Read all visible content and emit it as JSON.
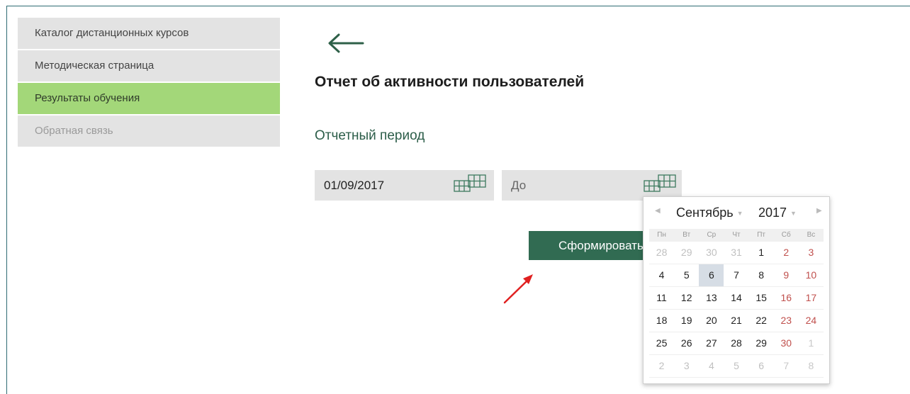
{
  "sidebar": {
    "items": [
      {
        "label": "Каталог дистанционных курсов"
      },
      {
        "label": "Методическая страница"
      },
      {
        "label": "Результаты обучения"
      },
      {
        "label": "Обратная связь"
      }
    ]
  },
  "main": {
    "title": "Отчет об активности пользователей",
    "period_label": "Отчетный период",
    "date_from": {
      "value": "01/09/2017"
    },
    "date_to": {
      "placeholder": "До"
    },
    "submit_label": "Сформировать"
  },
  "datepicker": {
    "month": "Сентябрь",
    "year": "2017",
    "weekdays": [
      "Пн",
      "Вт",
      "Ср",
      "Чт",
      "Пт",
      "Сб",
      "Вс"
    ],
    "weeks": [
      [
        "28",
        "29",
        "30",
        "31",
        "1",
        "2",
        "3"
      ],
      [
        "4",
        "5",
        "6",
        "7",
        "8",
        "9",
        "10"
      ],
      [
        "11",
        "12",
        "13",
        "14",
        "15",
        "16",
        "17"
      ],
      [
        "18",
        "19",
        "20",
        "21",
        "22",
        "23",
        "24"
      ],
      [
        "25",
        "26",
        "27",
        "28",
        "29",
        "30",
        "1"
      ],
      [
        "2",
        "3",
        "4",
        "5",
        "6",
        "7",
        "8"
      ]
    ],
    "today": "6"
  },
  "colors": {
    "accent": "#316b52",
    "active_nav": "#a3d779",
    "weekend": "#c0504d",
    "arrow": "#e02020"
  },
  "icons": {
    "back": "arrow-left-icon",
    "calendar": "calendar-grid-icon"
  }
}
